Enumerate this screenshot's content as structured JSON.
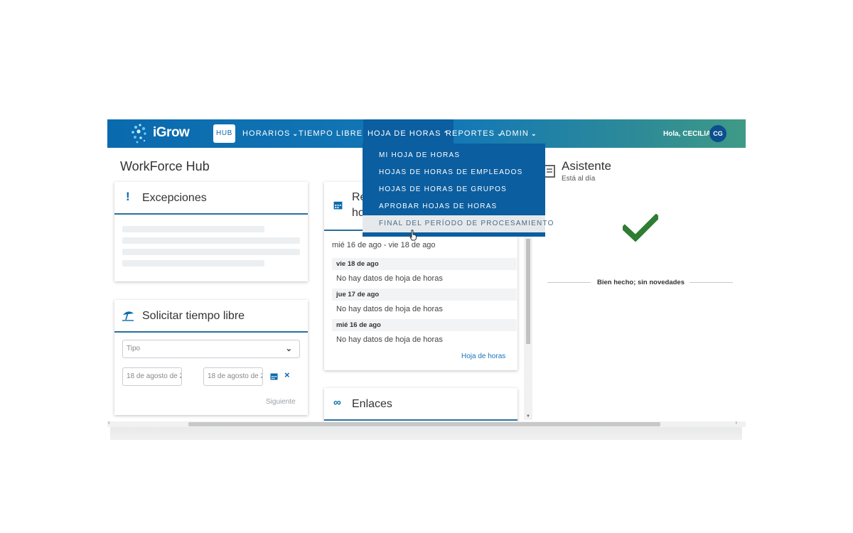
{
  "navbar": {
    "logo_text": "iGrow",
    "hub_label": "HUB",
    "items": [
      {
        "label": "HORARIOS"
      },
      {
        "label": "TIEMPO LIBRE"
      },
      {
        "label": "HOJA DE HORAS"
      },
      {
        "label": "REPORTES"
      },
      {
        "label": "ADMIN"
      }
    ],
    "greeting": "Hola, CECILIA",
    "avatar_initials": "CG",
    "colors": {
      "primary": "#0a6aae",
      "dropdown": "#0b5ea0",
      "accent_end": "#3f9a85"
    }
  },
  "dropdown": {
    "items": [
      {
        "label": "MI HOJA DE HORAS"
      },
      {
        "label": "HOJAS DE HORAS DE EMPLEADOS"
      },
      {
        "label": "HOJAS DE HORAS DE GRUPOS"
      },
      {
        "label": "APROBAR HOJAS DE HORAS"
      },
      {
        "label": "FINAL DEL PERÍODO DE PROCESAMIENTO"
      }
    ],
    "hovered_index": 4
  },
  "page": {
    "title": "WorkForce Hub"
  },
  "excepciones": {
    "title": "Excepciones",
    "icon": "exclamation-icon"
  },
  "tiempo_libre": {
    "title": "Solicitar tiempo libre",
    "icon": "beach-umbrella-icon",
    "tipo_placeholder": "Tipo",
    "fecha_inicio": "18 de agosto de 2",
    "fecha_fin": "18 de agosto de 2",
    "next_label": "Siguiente"
  },
  "hoja_card": {
    "title_line1": "Re",
    "title_line2": "ho",
    "icon": "calendar-icon",
    "date_range": "mié 16 de ago - vie 18 de ago",
    "days": [
      {
        "day": "vie 18 de ago",
        "text": "No hay datos de hoja de horas"
      },
      {
        "day": "jue 17 de ago",
        "text": "No hay datos de hoja de horas"
      },
      {
        "day": "mié 16 de ago",
        "text": "No hay datos de hoja de horas"
      }
    ],
    "link_label": "Hoja de horas"
  },
  "enlaces": {
    "title": "Enlaces",
    "icon": "link-icon"
  },
  "asistente": {
    "title": "Asistente",
    "subtitle": "Está al día",
    "icon": "assistant-icon",
    "status_icon": "checkmark-icon",
    "status_color": "#2e7d32",
    "message": "Bien hecho; sin novedades"
  }
}
